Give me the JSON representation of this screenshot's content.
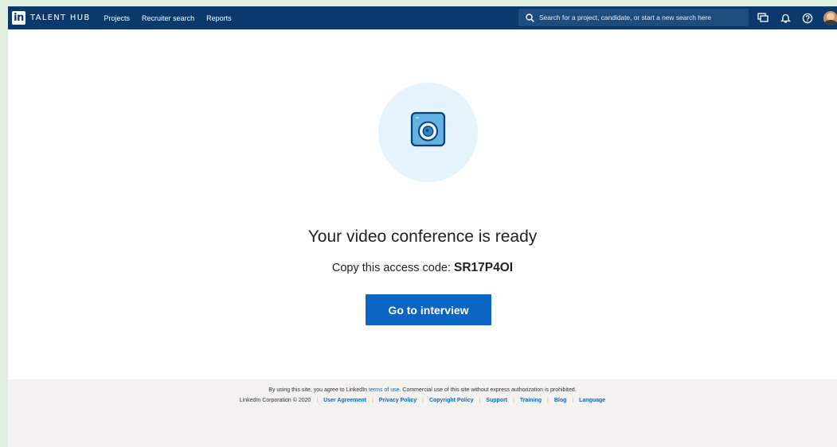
{
  "header": {
    "logo_mark": "in",
    "brand": "TALENT HUB",
    "nav": [
      "Projects",
      "Recruiter search",
      "Reports"
    ],
    "search_placeholder": "Search for a project, candidate, or start a new search here",
    "icons": [
      "messages-icon",
      "bell-icon",
      "help-icon",
      "avatar"
    ]
  },
  "main": {
    "title": "Your video conference is ready",
    "access_label": "Copy this access code:",
    "access_code": "SR17P4OI",
    "button": "Go to interview"
  },
  "footer": {
    "line1_pre": "By using this site, you agree to LinkedIn",
    "terms_link": "terms of use",
    "line1_post": ". Commercial use of this site without express authorization is prohibited.",
    "copyright": "LinkedIn Corporation © 2020",
    "links": [
      "User Agreement",
      "Privacy Policy",
      "Copyright Policy",
      "Support",
      "Training",
      "Blog",
      "Language"
    ]
  },
  "colors": {
    "header_bg": "#0a3a6b",
    "accent": "#0a66c2",
    "page_bg": "#dfeedd",
    "footer_bg": "#f3f2ef"
  }
}
